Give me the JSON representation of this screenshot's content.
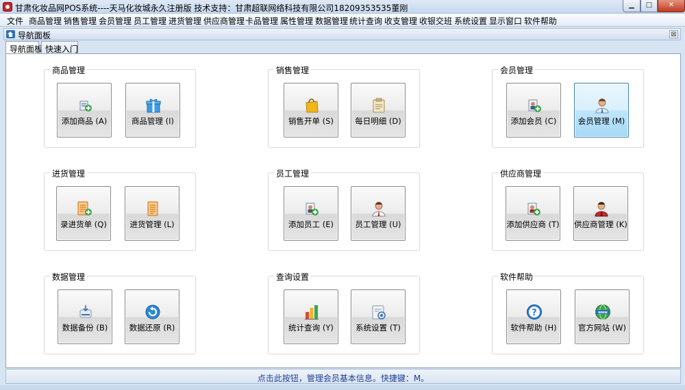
{
  "window": {
    "title": "甘肃化妆品网POS系统----天马化妆城永久注册版  技术支持：甘肃超联网络科技有限公司18209353535董刚",
    "min_label": "▁",
    "max_label": "□",
    "close_label": "✕"
  },
  "menu": [
    "文件",
    "商品管理",
    "销售管理",
    "会员管理",
    "员工管理",
    "进货管理",
    "供应商管理",
    "卡品管理",
    "属性管理",
    "数据管理",
    "统计查询",
    "收支管理",
    "收银交班",
    "系统设置",
    "显示窗口",
    "软件帮助"
  ],
  "panel": {
    "title": "导航面板",
    "close_label": "⊠"
  },
  "tabs": [
    "导航面板",
    "快速入门"
  ],
  "groups": [
    {
      "title": "商品管理",
      "buttons": [
        {
          "label": "添加商品 (A)",
          "icon": "add-product-icon"
        },
        {
          "label": "商品管理 (I)",
          "icon": "gift-box-icon"
        }
      ]
    },
    {
      "title": "销售管理",
      "buttons": [
        {
          "label": "销售开单 (S)",
          "icon": "shopping-bag-icon"
        },
        {
          "label": "每日明细 (D)",
          "icon": "clipboard-icon"
        }
      ]
    },
    {
      "title": "会员管理",
      "buttons": [
        {
          "label": "添加会员 (C)",
          "icon": "add-member-icon"
        },
        {
          "label": "会员管理 (M)",
          "icon": "member-icon"
        }
      ]
    },
    {
      "title": "进货管理",
      "buttons": [
        {
          "label": "录进货单 (Q)",
          "icon": "add-purchase-order-icon"
        },
        {
          "label": "进货管理 (L)",
          "icon": "purchase-list-icon"
        }
      ]
    },
    {
      "title": "员工管理",
      "buttons": [
        {
          "label": "添加员工 (E)",
          "icon": "add-employee-icon"
        },
        {
          "label": "员工管理 (U)",
          "icon": "employee-icon"
        }
      ]
    },
    {
      "title": "供应商管理",
      "buttons": [
        {
          "label": "添加供应商 (T)",
          "icon": "add-supplier-icon"
        },
        {
          "label": "供应商管理 (K)",
          "icon": "supplier-icon"
        }
      ]
    },
    {
      "title": "数据管理",
      "buttons": [
        {
          "label": "数据备份 (B)",
          "icon": "backup-disk-icon"
        },
        {
          "label": "数据还原 (R)",
          "icon": "restore-icon"
        }
      ]
    },
    {
      "title": "查询设置",
      "buttons": [
        {
          "label": "统计查询 (Y)",
          "icon": "bar-chart-icon"
        },
        {
          "label": "系统设置 (T)",
          "icon": "settings-icon"
        }
      ]
    },
    {
      "title": "软件帮助",
      "buttons": [
        {
          "label": "软件帮助 (H)",
          "icon": "help-icon"
        },
        {
          "label": "官方网站 (W)",
          "icon": "website-globe-icon"
        }
      ]
    }
  ],
  "hovered_button": "会员管理 (M)",
  "status": "点击此按钮，管理会员基本信息。快捷键：M。",
  "colors": {
    "accent_blue": "#2f6fb3",
    "status_text": "#1f3e91",
    "hover_fill": "#bee6fd"
  }
}
